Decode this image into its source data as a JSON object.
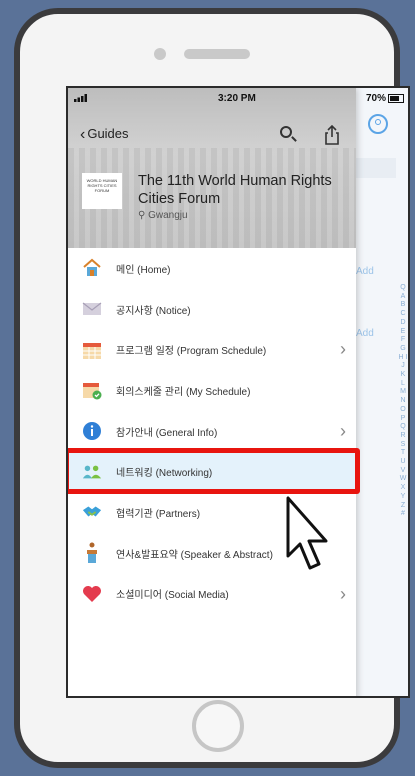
{
  "status_bar": {
    "time": "3:20 PM",
    "battery": "70%"
  },
  "header": {
    "back_label": "Guides",
    "title": "The 11th World Human Rights Cities Forum",
    "location": "Gwangju",
    "logo_text": "WORLD HUMAN RIGHTS CITIES FORUM"
  },
  "menu": {
    "items": [
      {
        "label": "메인 (Home)",
        "icon": "home-icon",
        "has_arrow": false
      },
      {
        "label": "공지사항 (Notice)",
        "icon": "envelope-icon",
        "has_arrow": false
      },
      {
        "label": "프로그램 일정 (Program Schedule)",
        "icon": "calendar-icon",
        "has_arrow": true
      },
      {
        "label": "회의스케줄 관리 (My Schedule)",
        "icon": "calendar-check-icon",
        "has_arrow": false
      },
      {
        "label": "참가안내 (General  Info)",
        "icon": "info-icon",
        "has_arrow": true
      },
      {
        "label": "네트워킹 (Networking)",
        "icon": "people-icon",
        "has_arrow": false,
        "highlighted": true
      },
      {
        "label": "협력기관 (Partners)",
        "icon": "handshake-icon",
        "has_arrow": false
      },
      {
        "label": "연사&발표요약 (Speaker & Abstract)",
        "icon": "podium-icon",
        "has_arrow": false
      },
      {
        "label": "소셜미디어 (Social Media)",
        "icon": "heart-icon",
        "has_arrow": true
      }
    ]
  },
  "background": {
    "add_label": "Add",
    "index_letters": "Q A B C D E F G H I J K L M N O P Q R S T U V W X Y Z #"
  },
  "colors": {
    "highlight": "#e8150f",
    "active_row": "#e4f2fb",
    "accent": "#5ba4e6"
  }
}
